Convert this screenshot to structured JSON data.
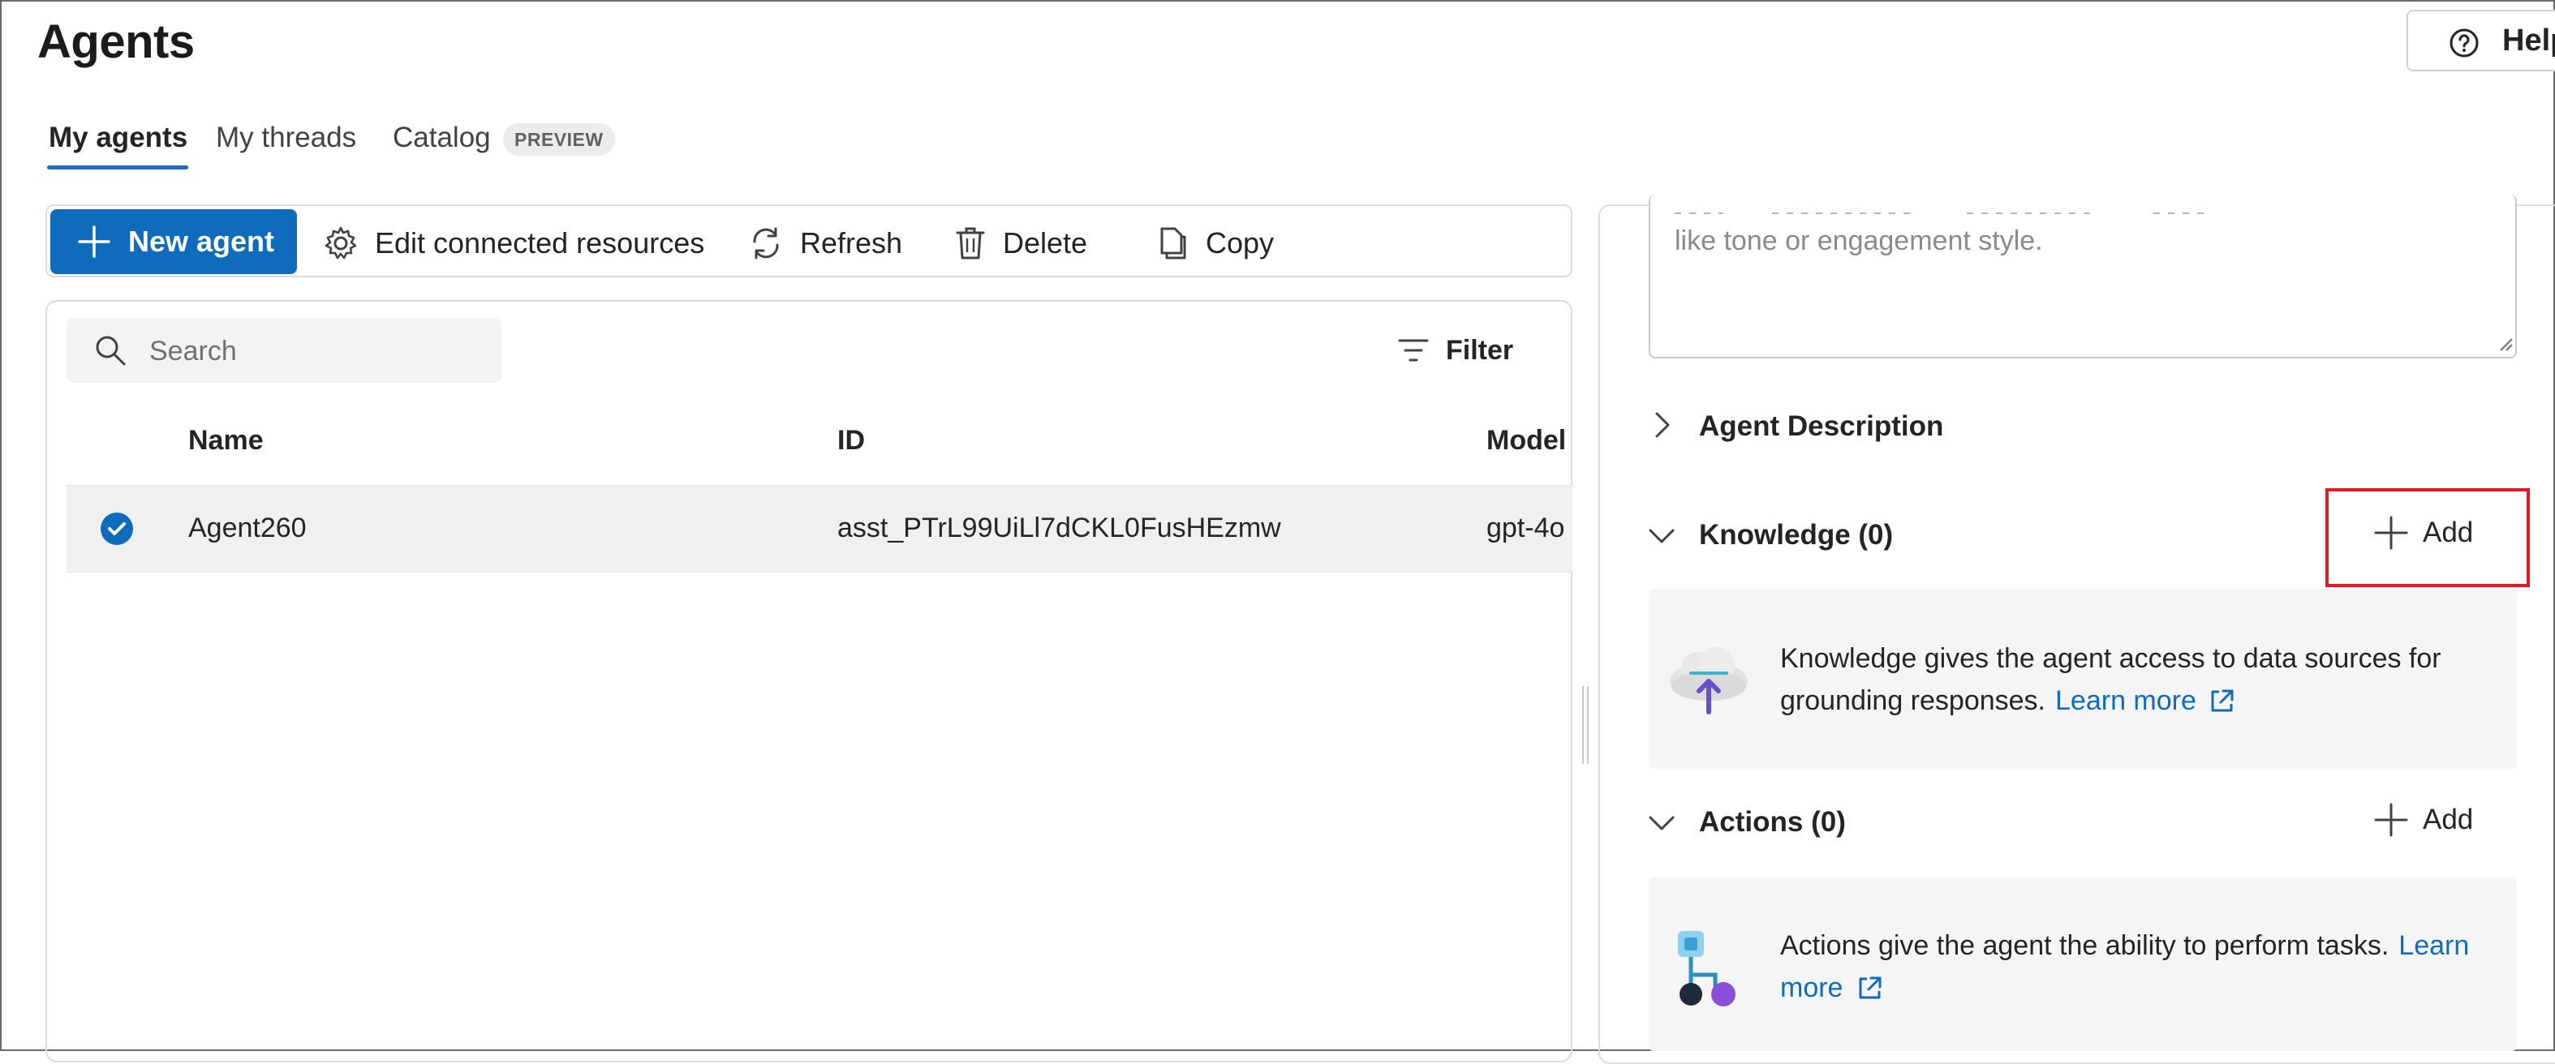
{
  "page": {
    "title": "Agents",
    "help_label": "Help"
  },
  "tabs": [
    {
      "label": "My agents",
      "active": true
    },
    {
      "label": "My threads",
      "active": false
    },
    {
      "label": "Catalog",
      "active": false,
      "badge": "PREVIEW"
    }
  ],
  "toolbar": {
    "new_agent": "New agent",
    "edit_resources": "Edit connected resources",
    "refresh": "Refresh",
    "delete": "Delete",
    "copy": "Copy"
  },
  "list": {
    "search_placeholder": "Search",
    "filter_label": "Filter",
    "columns": [
      "Name",
      "ID",
      "Model"
    ],
    "rows": [
      {
        "selected": true,
        "name": "Agent260",
        "id": "asst_PTrL99UiLl7dCKL0FusHEzmw",
        "model": "gpt-4o"
      }
    ]
  },
  "details": {
    "instructions_visible_text": "like tone or engagement style.",
    "agent_description_label": "Agent Description",
    "knowledge": {
      "label": "Knowledge (0)",
      "add_label": "Add",
      "info_line1": "Knowledge gives the agent access to data sources for",
      "info_line2": "grounding responses.",
      "learn_more": "Learn more"
    },
    "actions": {
      "label": "Actions (0)",
      "add_label": "Add",
      "info_line1": "Actions give the agent the ability to perform tasks.",
      "learn_more_part1": "Learn",
      "learn_more_part2": "more"
    }
  },
  "colors": {
    "accent": "#0f6cbd",
    "highlight": "#e01b24",
    "selected_row": "#f0f0f0"
  }
}
